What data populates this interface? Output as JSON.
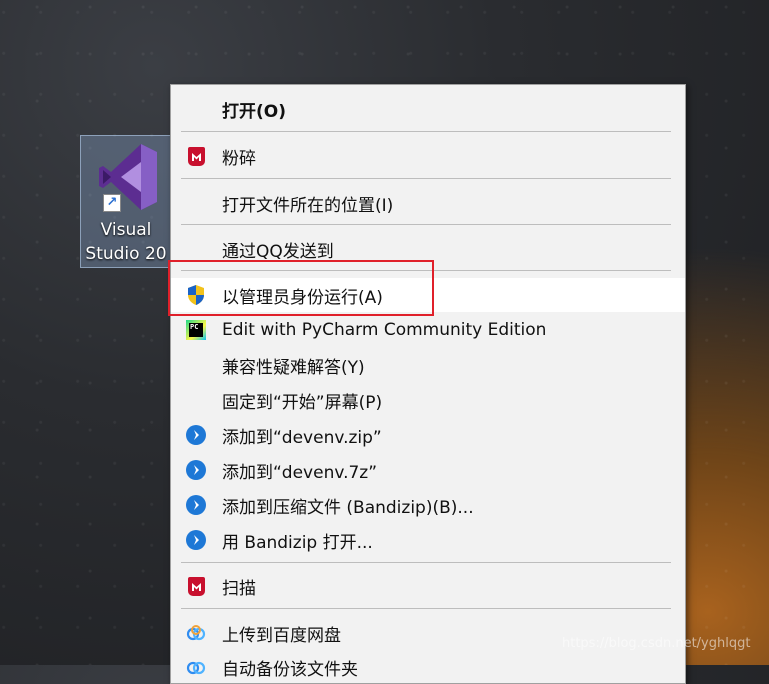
{
  "desktop": {
    "icon_label": "Visual\nStudio 20",
    "watermark": "https://blog.csdn.net/yghlqgt"
  },
  "menu": {
    "items": [
      {
        "label": "打开(O)",
        "icon": "none",
        "bold": true
      },
      {
        "label": "粉碎",
        "icon": "mcafee-shield-icon"
      },
      {
        "label": "打开文件所在的位置(I)",
        "icon": "none"
      },
      {
        "label": "通过QQ发送到",
        "icon": "none"
      },
      {
        "label": "以管理员身份运行(A)",
        "icon": "uac-shield-icon",
        "highlighted": true
      },
      {
        "label": "Edit with PyCharm Community Edition",
        "icon": "pycharm-icon"
      },
      {
        "label": "兼容性疑难解答(Y)",
        "icon": "none"
      },
      {
        "label": "固定到“开始”屏幕(P)",
        "icon": "none"
      },
      {
        "label": "添加到“devenv.zip”",
        "icon": "bandizip-icon"
      },
      {
        "label": "添加到“devenv.7z”",
        "icon": "bandizip-icon"
      },
      {
        "label": "添加到压缩文件 (Bandizip)(B)...",
        "icon": "bandizip-icon"
      },
      {
        "label": "用 Bandizip 打开...",
        "icon": "bandizip-icon"
      },
      {
        "label": "扫描",
        "icon": "mcafee-shield-icon"
      },
      {
        "label": "上传到百度网盘",
        "icon": "baidu-netdisk-icon"
      },
      {
        "label": "自动备份该文件夹",
        "icon": "baidu-netdisk-icon"
      }
    ]
  },
  "colors": {
    "highlight_box": "#e0202a",
    "bandizip_blue": "#1e78d6",
    "mcafee_red": "#c8102e",
    "vs_purple": "#865fc5"
  }
}
